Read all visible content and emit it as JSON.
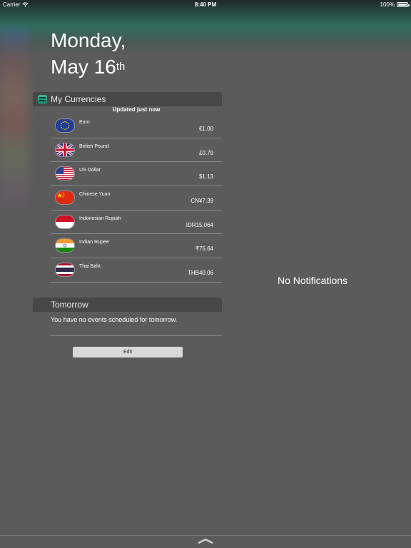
{
  "status_bar": {
    "carrier": "Carrier",
    "time": "8:40 PM",
    "battery": "100%"
  },
  "date": {
    "weekday": "Monday,",
    "month_day": "May 16",
    "ordinal": "th"
  },
  "currencies_widget": {
    "title": "My Currencies",
    "updated": "Updated just now",
    "items": [
      {
        "name": "Euro",
        "value": "€1.00",
        "flag": "eu-flag-icon"
      },
      {
        "name": "British Pound",
        "value": "£0.79",
        "flag": "uk-flag-icon"
      },
      {
        "name": "US Dollar",
        "value": "$1.13",
        "flag": "us-flag-icon"
      },
      {
        "name": "Chinese Yuan",
        "value": "CN¥7.39",
        "flag": "cn-flag-icon"
      },
      {
        "name": "Indonesian Rupiah",
        "value": "IDR15,064",
        "flag": "id-flag-icon"
      },
      {
        "name": "Indian Rupee",
        "value": "₹75.64",
        "flag": "in-flag-icon"
      },
      {
        "name": "Thai Baht",
        "value": "THB40.06",
        "flag": "th-flag-icon"
      }
    ]
  },
  "tomorrow_widget": {
    "title": "Tomorrow",
    "message": "You have no events scheduled for tomorrow."
  },
  "edit_label": "Edit",
  "notifications": {
    "empty_text": "No Notifications"
  },
  "colors": {
    "background": "#5b5b5b",
    "widget_header": "#474747",
    "accent_teal": "#2f6d5e"
  }
}
